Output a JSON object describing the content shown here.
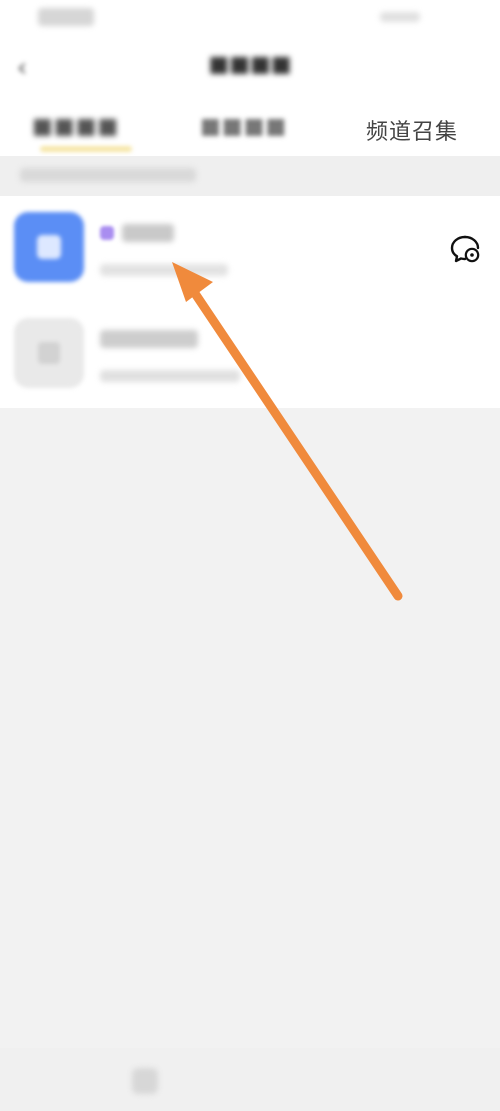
{
  "status_bar": {},
  "header": {
    "back_icon": "chevron-left-icon"
  },
  "tabs": [
    {
      "label": "",
      "selected": true
    },
    {
      "label": "",
      "selected": false
    },
    {
      "label": "频道召集",
      "selected": false
    }
  ],
  "colors": {
    "accent_underline": "#f6e6a6",
    "avatar_blue": "#5b8ef5",
    "annotation_arrow": "#f08a3c"
  },
  "channel_list": {
    "items": [
      {
        "icon": "channel-avatar"
      },
      {
        "icon": "channel-avatar-placeholder"
      }
    ],
    "action_icon": "chat-settings-icon"
  },
  "annotation": {
    "icon": "arrow-icon"
  }
}
